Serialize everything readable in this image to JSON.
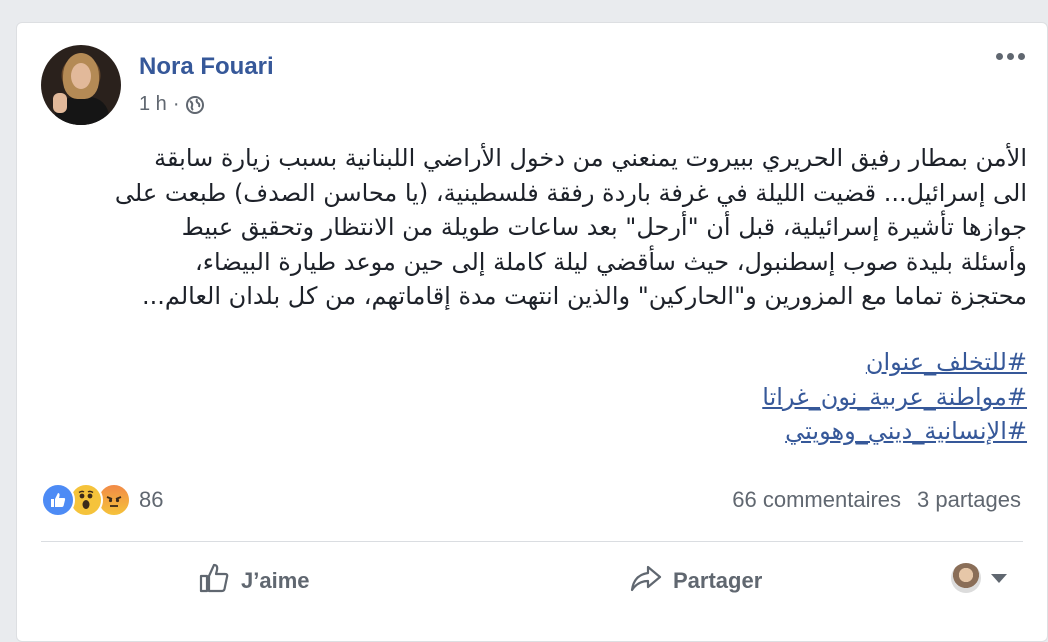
{
  "post": {
    "author": "Nora Fouari",
    "time": "1 h",
    "time_separator": "·",
    "text_lines": [
      "الأمن بمطار رفيق الحريري ببيروت يمنعني من دخول الأراضي اللبنانية بسبب زيارة سابقة",
      "الى إسرائيل... قضيت الليلة في غرفة باردة رفقة فلسطينية، (يا محاسن الصدف) طبعت على",
      "جوازها تأشيرة إسرائيلية، قبل أن \"أرحل\" بعد ساعات طويلة من الانتظار وتحقيق عبيط",
      "وأسئلة بليدة صوب إسطنبول، حيث سأقضي ليلة كاملة إلى حين موعد طيارة البيضاء،",
      "محتجزة تماما مع المزورين و\"الحاركين\" والذين انتهت مدة إقاماتهم، من كل بلدان العالم..."
    ],
    "hashtags": [
      "#للتخلف_عنوان",
      "#مواطنة_عربية_نون_غراتا",
      "#الإنسانية_ديني_وهويتي"
    ]
  },
  "reactions": {
    "icons": [
      "like-icon",
      "wow-icon",
      "angry-icon"
    ],
    "count": "86"
  },
  "stats": {
    "comments": "66 commentaires",
    "shares": "3 partages"
  },
  "actions": {
    "like_label": "J’aime",
    "share_label": "Partager"
  },
  "colors": {
    "link": "#365899",
    "meta": "#606770",
    "text": "#1d2129",
    "like_blue": "#4d8bf5"
  }
}
